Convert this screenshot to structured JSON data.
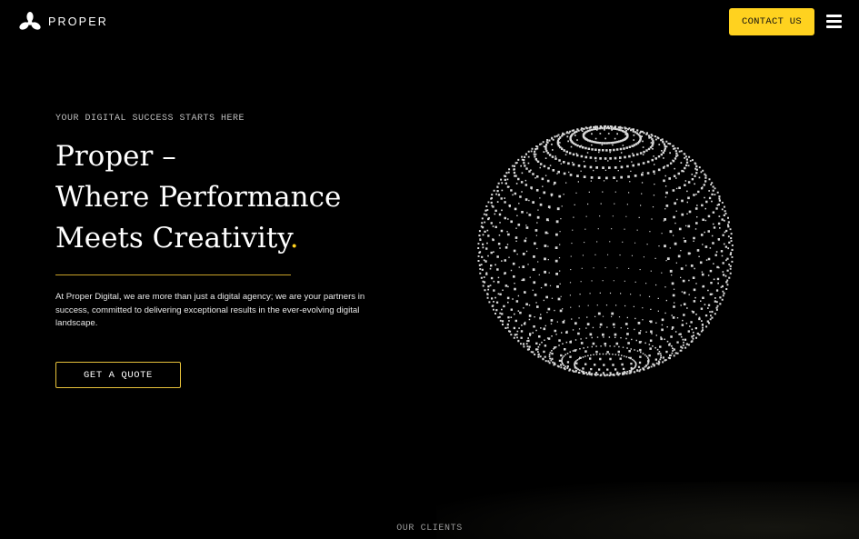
{
  "header": {
    "brand": "PROPER",
    "logo_icon": "propeller-logo-icon",
    "contact_label": "CONTACT US",
    "menu_icon": "hamburger-menu-icon"
  },
  "hero": {
    "eyebrow": "YOUR DIGITAL SUCCESS STARTS HERE",
    "headline_line1": "Proper –",
    "headline_line2": "Where Performance",
    "headline_line3": "Meets Creativity",
    "headline_dot": ".",
    "intro": "At Proper Digital, we are more than just a digital agency; we are your partners in success, committed to delivering exceptional results in the ever-evolving digital landscape.",
    "cta_label": "GET A QUOTE",
    "graphic": "wireframe-sphere-graphic"
  },
  "clients": {
    "label": "OUR CLIENTS"
  },
  "colors": {
    "background": "#000000",
    "accent": "#ffd21f",
    "divider": "#c9a227",
    "text": "#ffffff"
  }
}
